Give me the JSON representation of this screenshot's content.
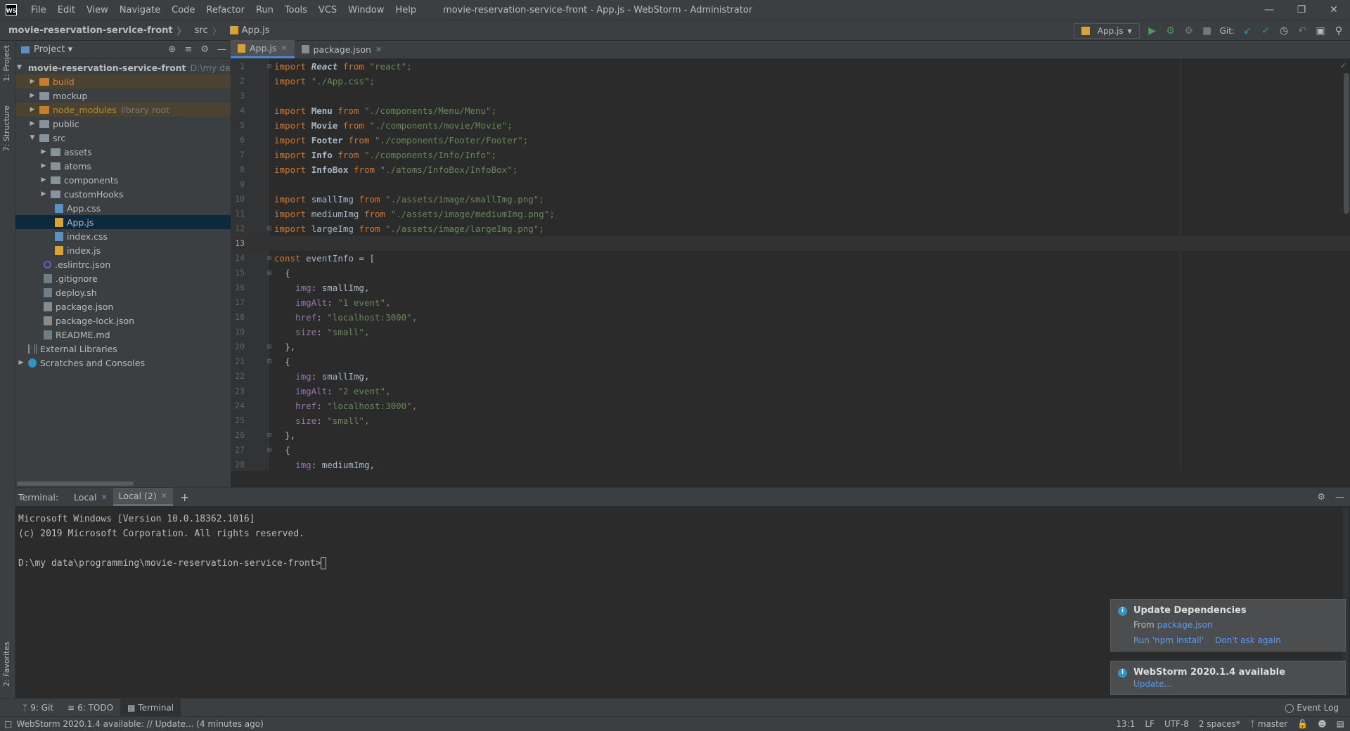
{
  "titlebar": {
    "logo": "WS",
    "menu": [
      "File",
      "Edit",
      "View",
      "Navigate",
      "Code",
      "Refactor",
      "Run",
      "Tools",
      "VCS",
      "Window",
      "Help"
    ],
    "title": "movie-reservation-service-front - App.js - WebStorm - Administrator"
  },
  "navbar": {
    "crumbs": [
      "movie-reservation-service-front",
      "src",
      "App.js"
    ],
    "run_config": "App.js",
    "git_label": "Git:"
  },
  "left_stripe": {
    "project_tab": "1: Project",
    "structure_tab": "7: Structure",
    "favorites_tab": "2: Favorites"
  },
  "project": {
    "title": "Project",
    "root_name": "movie-reservation-service-front",
    "root_path": "D:\\my data\\p",
    "items": [
      {
        "name": "build"
      },
      {
        "name": "mockup"
      },
      {
        "name": "node_modules",
        "hint": "library root"
      },
      {
        "name": "public"
      },
      {
        "name": "src"
      },
      {
        "name": "assets"
      },
      {
        "name": "atoms"
      },
      {
        "name": "components"
      },
      {
        "name": "customHooks"
      },
      {
        "name": "App.css"
      },
      {
        "name": "App.js"
      },
      {
        "name": "index.css"
      },
      {
        "name": "index.js"
      },
      {
        "name": ".eslintrc.json"
      },
      {
        "name": ".gitignore"
      },
      {
        "name": "deploy.sh"
      },
      {
        "name": "package.json"
      },
      {
        "name": "package-lock.json"
      },
      {
        "name": "README.md"
      },
      {
        "name": "External Libraries"
      },
      {
        "name": "Scratches and Consoles"
      }
    ]
  },
  "editor": {
    "tabs": [
      "App.js",
      "package.json"
    ],
    "line_numbers": [
      "1",
      "2",
      "3",
      "4",
      "5",
      "6",
      "7",
      "8",
      "9",
      "10",
      "11",
      "12",
      "13",
      "14",
      "15",
      "16",
      "17",
      "18",
      "19",
      "20",
      "21",
      "22",
      "23",
      "24",
      "25",
      "26",
      "27",
      "28"
    ],
    "imports": {
      "kw_import": "import",
      "kw_from": "from",
      "react": "React",
      "react_src": "\"react\";",
      "app_css": "\"./App.css\";",
      "menu": "Menu",
      "menu_src": "\"./components/Menu/Menu\";",
      "movie": "Movie",
      "movie_src": "\"./components/movie/Movie\";",
      "footer": "Footer",
      "footer_src": "\"./components/Footer/Footer\";",
      "info": "Info",
      "info_src": "\"./components/Info/Info\";",
      "infobox": "InfoBox",
      "infobox_src": "\"./atoms/InfoBox/InfoBox\";",
      "small": "smallImg",
      "small_src": "\"./assets/image/smallImg.png\";",
      "medium": "mediumImg",
      "medium_src": "\"./assets/image/mediumImg.png\";",
      "large": "largeImg",
      "large_src": "\"./assets/image/largeImg.png\";"
    },
    "body": {
      "kw_const": "const",
      "decl": " eventInfo = [",
      "open": "{",
      "close": "},",
      "img_key": "img",
      "alt_key": "imgAlt",
      "href_key": "href",
      "size_key": "size",
      "small_val": " smallImg,",
      "medium_val": " mediumImg,",
      "alt1": "\"1 event\"",
      "alt2": "\"2 event\"",
      "href_val": "\"localhost:3000\"",
      "size_val": "\"small\"",
      "colon": ":",
      "comma": ","
    }
  },
  "terminal": {
    "label": "Terminal:",
    "tabs": [
      "Local",
      "Local (2)"
    ],
    "lines": [
      "Microsoft Windows [Version 10.0.18362.1016]",
      "(c) 2019 Microsoft Corporation. All rights reserved.",
      "",
      "D:\\my data\\programming\\movie-reservation-service-front>"
    ]
  },
  "notifications": [
    {
      "title": "Update Dependencies",
      "from_label": "From",
      "from_link": "package.json",
      "actions": [
        "Run 'npm install'",
        "Don't ask again"
      ]
    },
    {
      "title": "WebStorm 2020.1.4 available",
      "action": "Update..."
    }
  ],
  "bottom_tools": {
    "items": [
      "9: Git",
      "6: TODO",
      "Terminal"
    ],
    "event_log": "Event Log"
  },
  "statusbar": {
    "message": "WebStorm 2020.1.4 available: // Update... (4 minutes ago)",
    "position": "13:1",
    "line_sep": "LF",
    "encoding": "UTF-8",
    "indent": "2 spaces*",
    "branch": "master"
  }
}
